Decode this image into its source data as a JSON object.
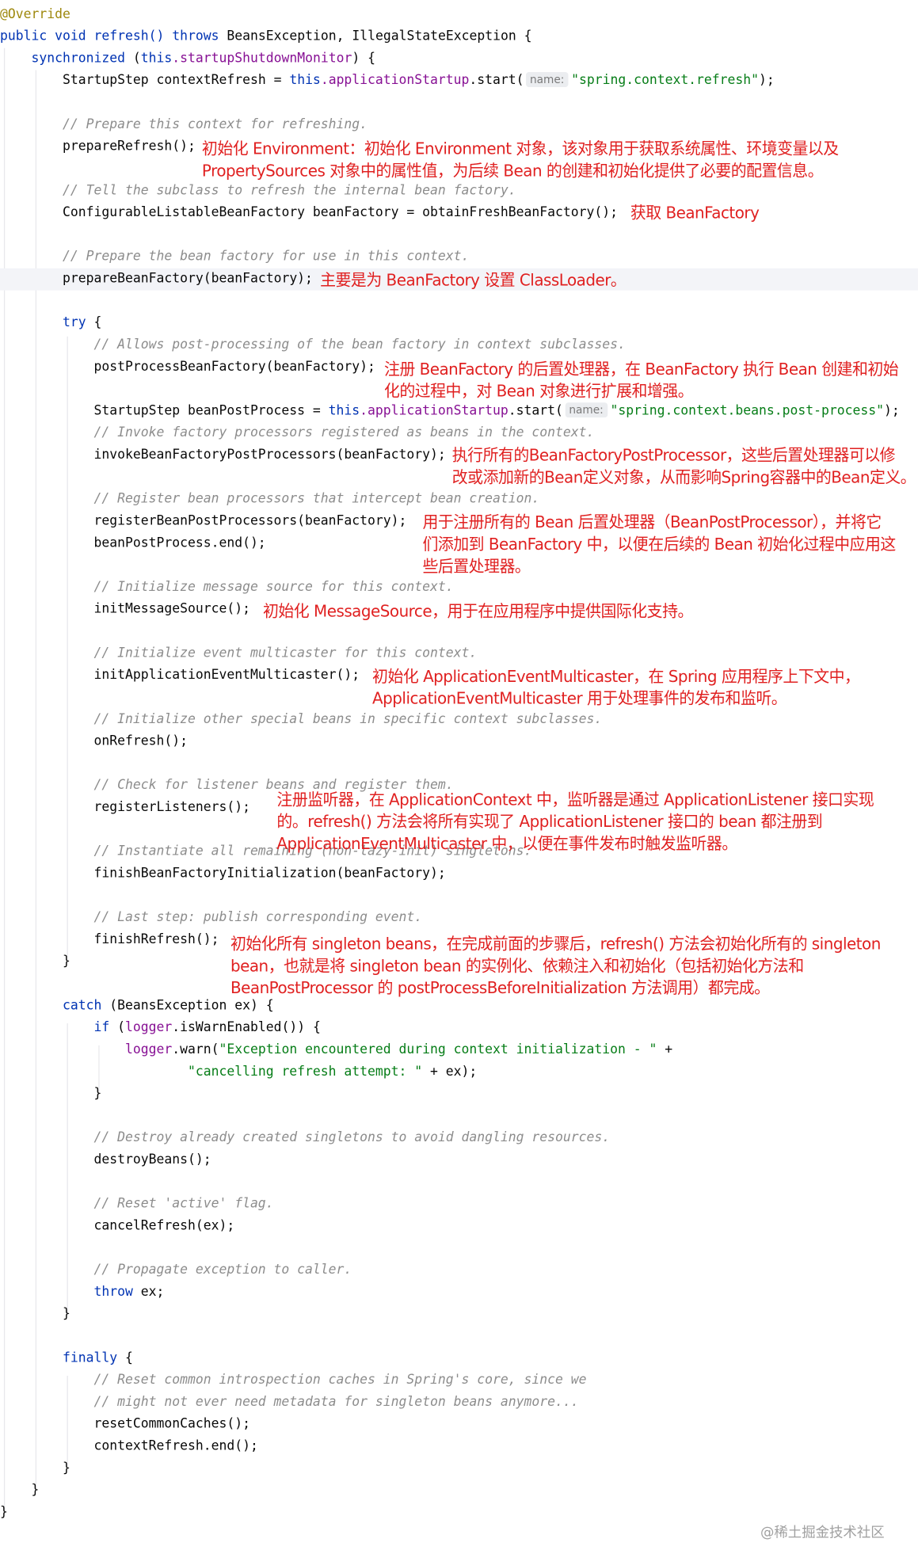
{
  "code": {
    "l01": "@Override",
    "l02_kw1": "public",
    "l02_kw2": "void",
    "l02_fn": "refresh()",
    "l02_kw3": "throws",
    "l02_rest": " BeansException, IllegalStateException {",
    "l03_kw": "synchronized",
    "l03_a": " (",
    "l03_this": "this",
    "l03_fld": ".startupShutdownMonitor",
    "l03_b": ") {",
    "l04_a": "StartupStep contextRefresh = ",
    "l04_this": "this",
    "l04_fld": ".applicationStartup",
    "l04_b": ".start(",
    "l04_hint": "name:",
    "l04_str": "\"spring.context.refresh\"",
    "l04_c": ");",
    "l06": "// Prepare this context for refreshing.",
    "l07": "prepareRefresh();",
    "l08": "// Tell the subclass to refresh the internal bean factory.",
    "l09": "ConfigurableListableBeanFactory beanFactory = obtainFreshBeanFactory();",
    "l11": "// Prepare the bean factory for use in this context.",
    "l12": "prepareBeanFactory(beanFactory);",
    "l14_kw": "try",
    "l14_rest": " {",
    "l15": "// Allows post-processing of the bean factory in context subclasses.",
    "l16": "postProcessBeanFactory(beanFactory);",
    "l17_a": "StartupStep beanPostProcess = ",
    "l17_this": "this",
    "l17_fld": ".applicationStartup",
    "l17_b": ".start(",
    "l17_hint": "name:",
    "l17_str": "\"spring.context.beans.post-process\"",
    "l17_c": ");",
    "l18": "// Invoke factory processors registered as beans in the context.",
    "l19": "invokeBeanFactoryPostProcessors(beanFactory);",
    "l20": "// Register bean processors that intercept bean creation.",
    "l21": "registerBeanPostProcessors(beanFactory);",
    "l22": "beanPostProcess.end();",
    "l24": "// Initialize message source for this context.",
    "l25": "initMessageSource();",
    "l27": "// Initialize event multicaster for this context.",
    "l28": "initApplicationEventMulticaster();",
    "l29": "// Initialize other special beans in specific context subclasses.",
    "l30": "onRefresh();",
    "l32": "// Check for listener beans and register them.",
    "l33": "registerListeners();",
    "l35": "// Instantiate all remaining (non-lazy-init) singletons.",
    "l36": "finishBeanFactoryInitialization(beanFactory);",
    "l38": "// Last step: publish corresponding event.",
    "l39": "finishRefresh();",
    "l40": "}",
    "l42_kw": "catch",
    "l42_rest": " (BeansException ex) {",
    "l43_kw": "if",
    "l43_a": " (",
    "l43_fld": "logger",
    "l43_b": ".isWarnEnabled()) {",
    "l44_fld": "logger",
    "l44_a": ".warn(",
    "l44_str": "\"Exception encountered during context initialization - \"",
    "l44_b": " +",
    "l45_str": "\"cancelling refresh attempt: \"",
    "l45_b": " + ex);",
    "l46": "}",
    "l48": "// Destroy already created singletons to avoid dangling resources.",
    "l49": "destroyBeans();",
    "l51": "// Reset 'active' flag.",
    "l52": "cancelRefresh(ex);",
    "l54": "// Propagate exception to caller.",
    "l55_kw": "throw",
    "l55_rest": " ex;",
    "l56": "}",
    "l58_kw": "finally",
    "l58_rest": " {",
    "l59": "// Reset common introspection caches in Spring's core, since we",
    "l60": "// might not ever need metadata for singleton beans anymore...",
    "l61": "resetCommonCaches();",
    "l62": "contextRefresh.end();",
    "l63": "}",
    "l64": "}",
    "l65": "}"
  },
  "notes": {
    "prepare_refresh": "初始化 Environment：初始化 Environment 对象，该对象用于获取系统属性、环境变量以及\nPropertySources 对象中的属性值，为后续 Bean 的创建和初始化提供了必要的配置信息。",
    "obtain_factory": "获取 BeanFactory",
    "prepare_factory": "主要是为 BeanFactory 设置 ClassLoader。",
    "post_process": "注册 BeanFactory 的后置处理器，在 BeanFactory 执行 Bean 创建和初始\n化的过程中，对 Bean 对象进行扩展和增强。",
    "invoke_processors": "执行所有的BeanFactoryPostProcessor，这些后置处理器可以修\n改或添加新的Bean定义对象，从而影响Spring容器中的Bean定义。",
    "register_processors": "用于注册所有的 Bean 后置处理器（BeanPostProcessor），并将它\n们添加到 BeanFactory 中，以便在后续的 Bean 初始化过程中应用这\n些后置处理器。",
    "message_source": "初始化 MessageSource，用于在应用程序中提供国际化支持。",
    "event_multicaster": "初始化 ApplicationEventMulticaster，在 Spring 应用程序上下文中，\nApplicationEventMulticaster 用于处理事件的发布和监听。",
    "listeners": "注册监听器，在 ApplicationContext 中，监听器是通过 ApplicationListener 接口实现\n的。refresh() 方法会将所有实现了 ApplicationListener 接口的 bean 都注册到\nApplicationEventMulticaster 中，以便在事件发布时触发监听器。",
    "finish_refresh": "初始化所有 singleton beans，在完成前面的步骤后，refresh() 方法会初始化所有的 singleton\nbean，也就是将 singleton bean 的实例化、依赖注入和初始化（包括初始化方法和\nBeanPostProcessor 的 postProcessBeforeInitialization 方法调用）都完成。"
  },
  "watermark": "@稀土掘金技术社区",
  "colors": {
    "keyword": "#0033b3",
    "annotation": "#9e880d",
    "field": "#871094",
    "string": "#067d17",
    "comment": "#8c8c8c",
    "note": "#e02020"
  }
}
